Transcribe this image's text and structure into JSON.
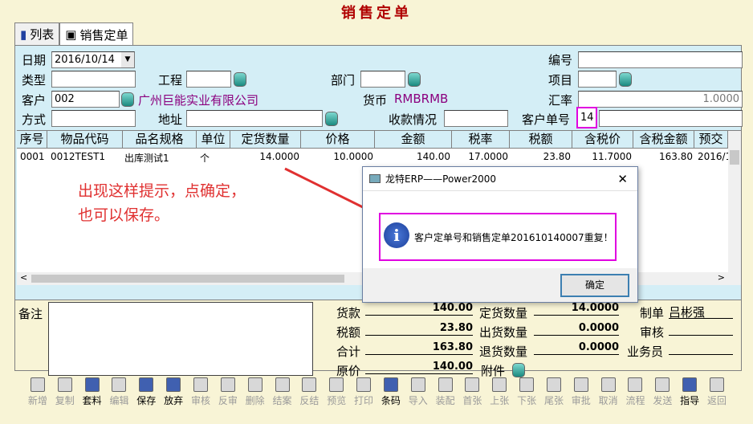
{
  "window_title": "销售定单",
  "tabs": [
    "列表",
    "销售定单"
  ],
  "form": {
    "date_label": "日期",
    "date_value": "2016/10/14",
    "number_label": "编号",
    "number_value": "",
    "type_label": "类型",
    "project_label": "工程",
    "dept_label": "部门",
    "item_label": "项目",
    "customer_label": "客户",
    "customer_code": "002",
    "customer_name": "广州巨能实业有限公司",
    "currency_label": "货币",
    "currency_value": "RMBRMB",
    "rate_label": "汇率",
    "rate_value": "1.0000",
    "method_label": "方式",
    "address_label": "地址",
    "payment_label": "收款情况",
    "cust_order_label": "客户单号",
    "cust_order_value": "14"
  },
  "grid": {
    "headers": [
      "序号",
      "物品代码",
      "品名规格",
      "单位",
      "定货数量",
      "价格",
      "金额",
      "税率",
      "税额",
      "含税价",
      "含税金额",
      "预交"
    ],
    "rows": [
      [
        "0001",
        "0012TEST1",
        "出库测试1",
        "个",
        "14.0000",
        "10.0000",
        "140.00",
        "17.0000",
        "23.80",
        "11.7000",
        "163.80",
        "2016/1"
      ]
    ]
  },
  "bottom": {
    "remark_label": "备注",
    "goods_label": "货款",
    "goods_value": "140.00",
    "tax_label": "税额",
    "tax_value": "23.80",
    "total_label": "合计",
    "total_value": "163.80",
    "orig_label": "原价",
    "orig_value": "140.00",
    "order_qty_label": "定货数量",
    "order_qty_value": "14.0000",
    "ship_qty_label": "出货数量",
    "ship_qty_value": "0.0000",
    "return_qty_label": "退货数量",
    "return_qty_value": "0.0000",
    "attach_label": "附件",
    "maker_label": "制单",
    "maker_value": "吕彬强",
    "audit_label": "审核",
    "sales_label": "业务员"
  },
  "toolbar": [
    "新增",
    "复制",
    "套料",
    "编辑",
    "保存",
    "放弃",
    "审核",
    "反审",
    "删除",
    "结案",
    "反结",
    "预览",
    "打印",
    "条码",
    "导入",
    "装配",
    "首张",
    "上张",
    "下张",
    "尾张",
    "审批",
    "取消",
    "流程",
    "发送",
    "指导",
    "返回"
  ],
  "toolbar_enabled": [
    false,
    false,
    true,
    false,
    true,
    true,
    false,
    false,
    false,
    false,
    false,
    false,
    false,
    true,
    false,
    false,
    false,
    false,
    false,
    false,
    false,
    false,
    false,
    false,
    true,
    false
  ],
  "dialog": {
    "title": "龙特ERP——Power2000",
    "message": "客户定单号和销售定单201610140007重复！",
    "ok_label": "确定",
    "close_label": "✕"
  },
  "annotation": "出现这样提示，点确定，\n也可以保存。",
  "annotation_color": "#e03030",
  "highlight_color": "#e000e0"
}
